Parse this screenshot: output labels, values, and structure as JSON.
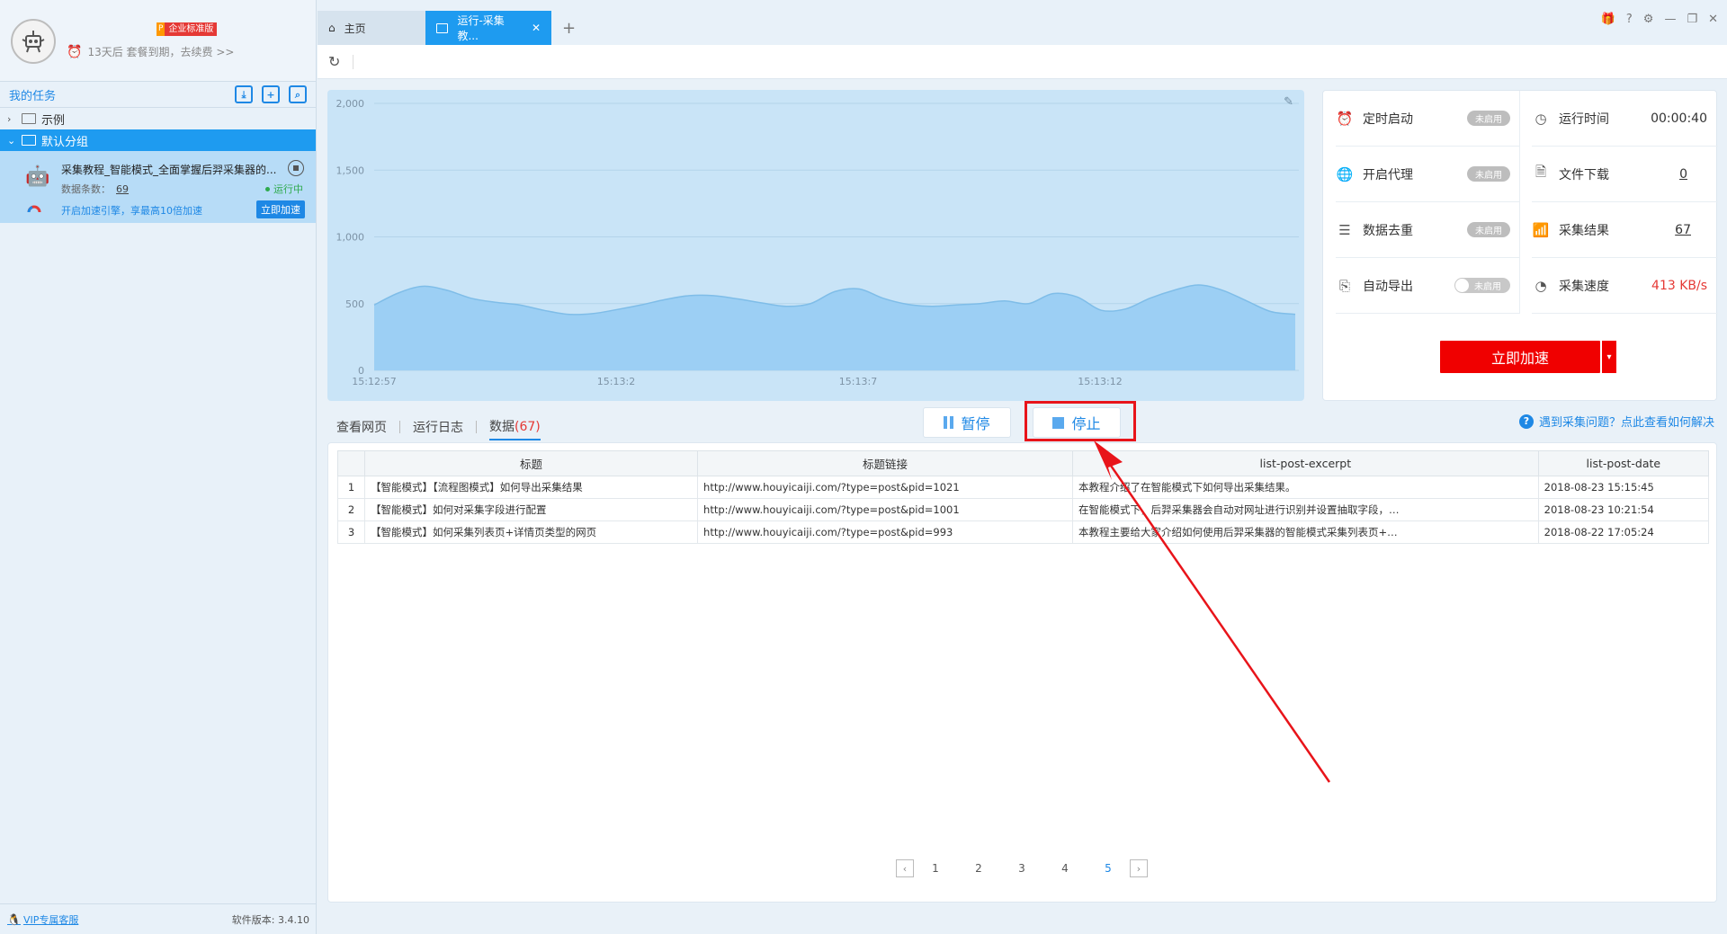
{
  "profile": {
    "edition_p": "P",
    "edition": "企业标准版",
    "expire_text": "13天后 套餐到期，去续费 >>"
  },
  "sidebar": {
    "title": "我的任务",
    "groups": [
      {
        "label": "示例",
        "expanded": false
      },
      {
        "label": "默认分组",
        "expanded": true
      }
    ],
    "task": {
      "name": "采集教程_智能模式_全面掌握后羿采集器的...",
      "count_label": "数据条数：",
      "count": "69",
      "status": "运行中",
      "speed_tip": "开启加速引擎，享最高10倍加速",
      "speed_button": "立即加速"
    },
    "footer": {
      "vip": "VIP专属客服",
      "version": "软件版本: 3.4.10"
    }
  },
  "tabs": {
    "home": "主页",
    "run": "运行-采集教..."
  },
  "chart_data": {
    "type": "area",
    "x_tick_labels": [
      "15:12:57",
      "15:13:2",
      "15:13:7",
      "15:13:12"
    ],
    "yticks": [
      "2,000",
      "1,500",
      "1,000",
      "500",
      "0"
    ],
    "ylim": [
      0,
      2000
    ],
    "x": [
      0,
      0.5,
      1,
      1.5,
      2,
      2.5,
      3,
      3.5,
      4,
      4.5,
      5,
      5.5,
      6,
      6.5,
      7,
      7.5,
      8,
      8.5,
      9,
      9.5,
      10,
      10.5,
      11,
      11.5,
      12,
      12.5,
      13,
      13.5,
      14,
      14.5,
      15,
      15.5,
      16,
      16.5,
      17,
      17.5,
      18,
      18.5,
      19
    ],
    "values": [
      490,
      580,
      630,
      600,
      540,
      510,
      490,
      450,
      420,
      425,
      455,
      490,
      530,
      560,
      560,
      535,
      505,
      480,
      500,
      590,
      610,
      540,
      495,
      480,
      490,
      500,
      520,
      500,
      575,
      550,
      450,
      460,
      540,
      600,
      640,
      600,
      520,
      440,
      420
    ],
    "fill_color": "#9ccff4",
    "line_color": "#7fbde8",
    "background": "#c9e4f7",
    "grid": true
  },
  "stats": {
    "schedule": {
      "label": "定时启动",
      "value": "未启用"
    },
    "runtime": {
      "label": "运行时间",
      "value": "00:00:40"
    },
    "proxy": {
      "label": "开启代理",
      "value": "未启用"
    },
    "download": {
      "label": "文件下载",
      "value": "0"
    },
    "dedupe": {
      "label": "数据去重",
      "value": "未启用"
    },
    "result": {
      "label": "采集结果",
      "value": "67"
    },
    "autoexport": {
      "label": "自动导出",
      "value": "未启用"
    },
    "speed": {
      "label": "采集速度",
      "value": "413 KB/s"
    },
    "accelerate": "立即加速"
  },
  "subtabs": {
    "view": "查看网页",
    "log": "运行日志",
    "data": "数据",
    "data_count": "(67)"
  },
  "actions": {
    "pause": "暂停",
    "stop": "停止",
    "help": "遇到采集问题？点此查看如何解决"
  },
  "table": {
    "headers": [
      "标题",
      "标题链接",
      "list-post-excerpt",
      "list-post-date"
    ],
    "rows": [
      [
        "1",
        "【智能模式】【流程图模式】如何导出采集结果",
        "http://www.houyicaiji.com/?type=post&pid=1021",
        "本教程介绍了在智能模式下如何导出采集结果。",
        "2018-08-23 15:15:45"
      ],
      [
        "2",
        "【智能模式】如何对采集字段进行配置",
        "http://www.houyicaiji.com/?type=post&pid=1001",
        "在智能模式下，后羿采集器会自动对网址进行识别并设置抽取字段，…",
        "2018-08-23 10:21:54"
      ],
      [
        "3",
        "【智能模式】如何采集列表页+详情页类型的网页",
        "http://www.houyicaiji.com/?type=post&pid=993",
        "本教程主要给大家介绍如何使用后羿采集器的智能模式采集列表页+…",
        "2018-08-22 17:05:24"
      ]
    ]
  },
  "pager": {
    "pages": [
      "1",
      "2",
      "3",
      "4",
      "5"
    ],
    "active": "5"
  }
}
